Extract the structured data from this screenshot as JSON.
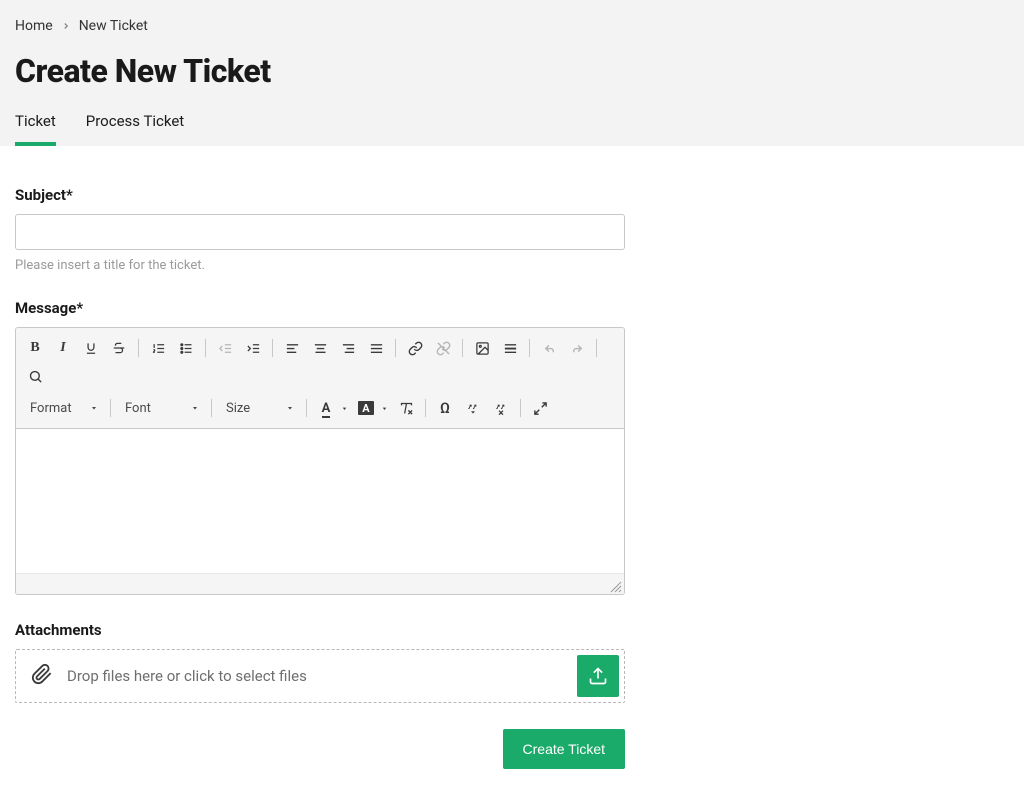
{
  "breadcrumb": {
    "home": "Home",
    "current": "New Ticket"
  },
  "page_title": "Create New Ticket",
  "tabs": {
    "ticket": "Ticket",
    "process_ticket": "Process Ticket"
  },
  "subject": {
    "label": "Subject*",
    "value": "",
    "help": "Please insert a title for the ticket."
  },
  "message": {
    "label": "Message*"
  },
  "editor": {
    "format_label": "Format",
    "font_label": "Font",
    "size_label": "Size"
  },
  "attachments": {
    "label": "Attachments",
    "dropzone_text": "Drop files here or click to select files"
  },
  "submit": {
    "label": "Create Ticket"
  },
  "colors": {
    "accent": "#1aab6a"
  }
}
